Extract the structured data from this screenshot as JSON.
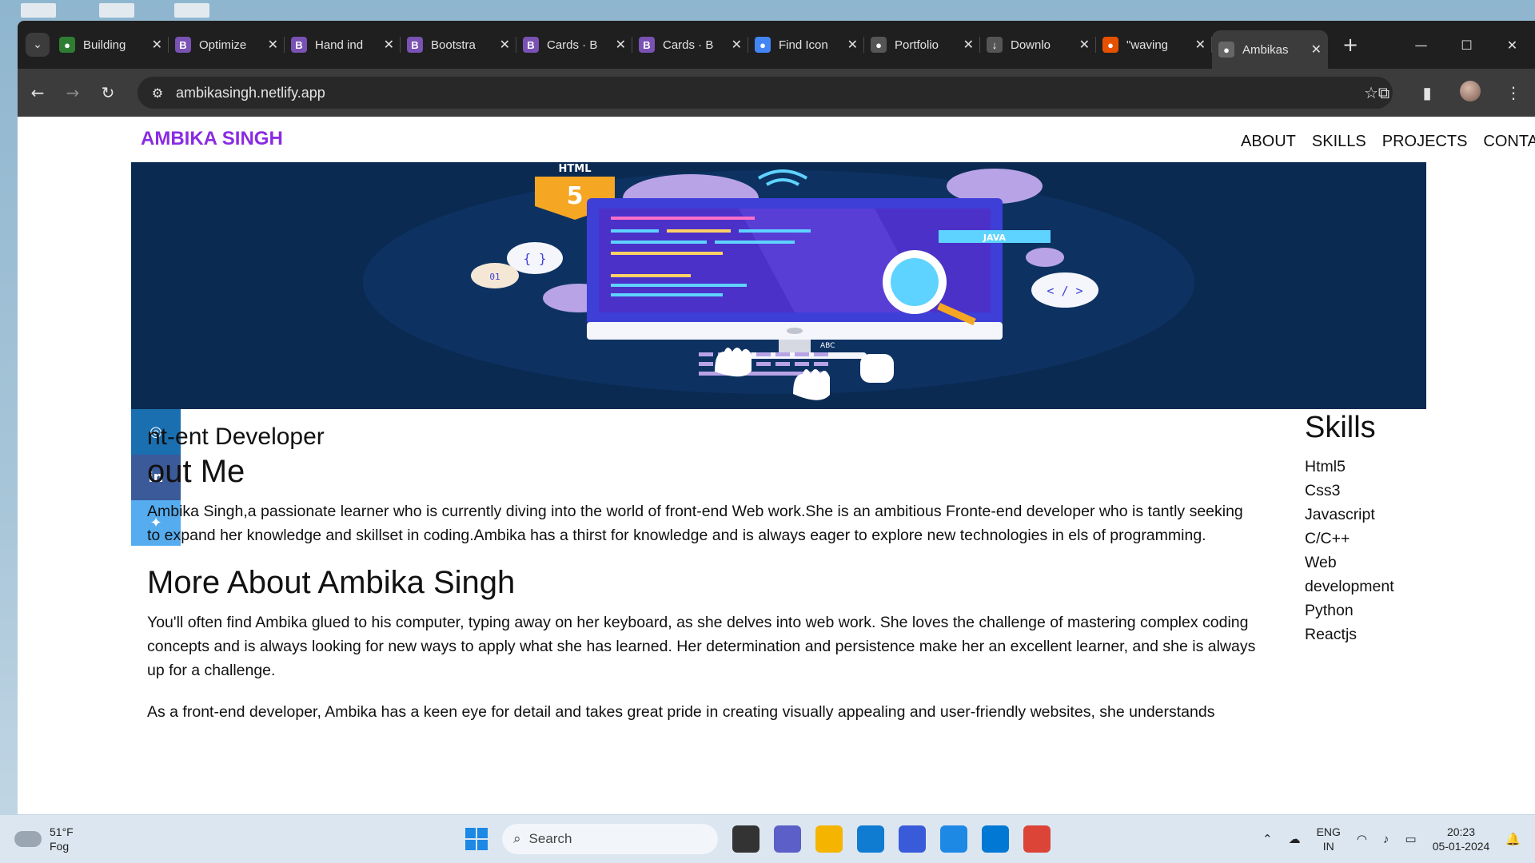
{
  "browser": {
    "tabs": [
      {
        "title": "Building",
        "icon": "codeium-icon",
        "color": "#2e7d32"
      },
      {
        "title": "Optimize",
        "icon": "bootstrap-icon",
        "color": "#7952b3"
      },
      {
        "title": "Hand ind",
        "icon": "bootstrap-icon",
        "color": "#7952b3"
      },
      {
        "title": "Bootstra",
        "icon": "bootstrap-icon",
        "color": "#7952b3"
      },
      {
        "title": "Cards · B",
        "icon": "bootstrap-icon",
        "color": "#7952b3"
      },
      {
        "title": "Cards · B",
        "icon": "bootstrap-icon",
        "color": "#7952b3"
      },
      {
        "title": "Find Icon",
        "icon": "flag-icon",
        "color": "#4285f4"
      },
      {
        "title": "Portfolio",
        "icon": "github-icon",
        "color": "#555555"
      },
      {
        "title": "Downlo",
        "icon": "download-icon",
        "color": "#555555"
      },
      {
        "title": "\"waving",
        "icon": "emoji-icon",
        "color": "#e65100"
      },
      {
        "title": "Ambikas",
        "icon": "globe-icon",
        "color": "#666666",
        "active": true
      }
    ],
    "url": "ambikasingh.netlify.app"
  },
  "site": {
    "brand": "AMBIKA SINGH",
    "brand_color": "#8a2be2",
    "nav": [
      "ABOUT",
      "SKILLS",
      "PROJECTS",
      "CONTACTS"
    ],
    "hero": {
      "html_label": "HTML",
      "html_number": "5",
      "java_label": "JAVA",
      "abc_label": "ABC",
      "braces": "{ }",
      "binary": "01",
      "tag": "< / >"
    },
    "social": [
      {
        "icon": "instagram-icon",
        "glyph": "◎",
        "color": "#1a6fb0"
      },
      {
        "icon": "linkedin-icon",
        "glyph": "in",
        "color": "#3b5a9a"
      },
      {
        "icon": "twitter-icon",
        "glyph": "✦",
        "color": "#55acee"
      }
    ],
    "role": "nt-ent Developer",
    "about_heading": "out Me",
    "about_text": "Ambika Singh,a passionate learner who is currently diving into the world of front-end Web work.She is an ambitious Fronte-end developer who is tantly seeking to expand her knowledge and skillset in coding.Ambika has a thirst for knowledge and is always eager to explore new technologies in els of programming.",
    "more_heading": "More About Ambika Singh",
    "more_text_1": "You'll often find Ambika glued to his computer, typing away on her keyboard, as she delves into web work. She loves the challenge of mastering complex coding concepts and is always looking for new ways to apply what she has learned. Her determination and persistence make her an excellent learner, and she is always up for a challenge.",
    "more_text_2": "As a front-end developer, Ambika has a keen eye for detail and takes great pride in creating visually appealing and user-friendly websites, she understands",
    "skills_heading": "Skills",
    "skills": [
      "Html5",
      "Css3",
      "Javascript",
      "C/C++",
      "Web development",
      "Python",
      "Reactjs"
    ]
  },
  "taskbar": {
    "temp": "51°F",
    "condition": "Fog",
    "search_label": "Search",
    "lang_top": "ENG",
    "lang_bottom": "IN",
    "time": "20:23",
    "date": "05-01-2024",
    "apps": [
      {
        "icon": "task-view-icon",
        "color": "#333333"
      },
      {
        "icon": "meet-icon",
        "color": "#5b5fc7"
      },
      {
        "icon": "file-explorer-icon",
        "color": "#f4b400"
      },
      {
        "icon": "edge-icon",
        "color": "#0f7bd1"
      },
      {
        "icon": "whiteboard-icon",
        "color": "#3a5bd9"
      },
      {
        "icon": "store-icon",
        "color": "#1e88e5"
      },
      {
        "icon": "vscode-icon",
        "color": "#0078d4"
      },
      {
        "icon": "chrome-icon",
        "color": "#db4437"
      }
    ]
  }
}
